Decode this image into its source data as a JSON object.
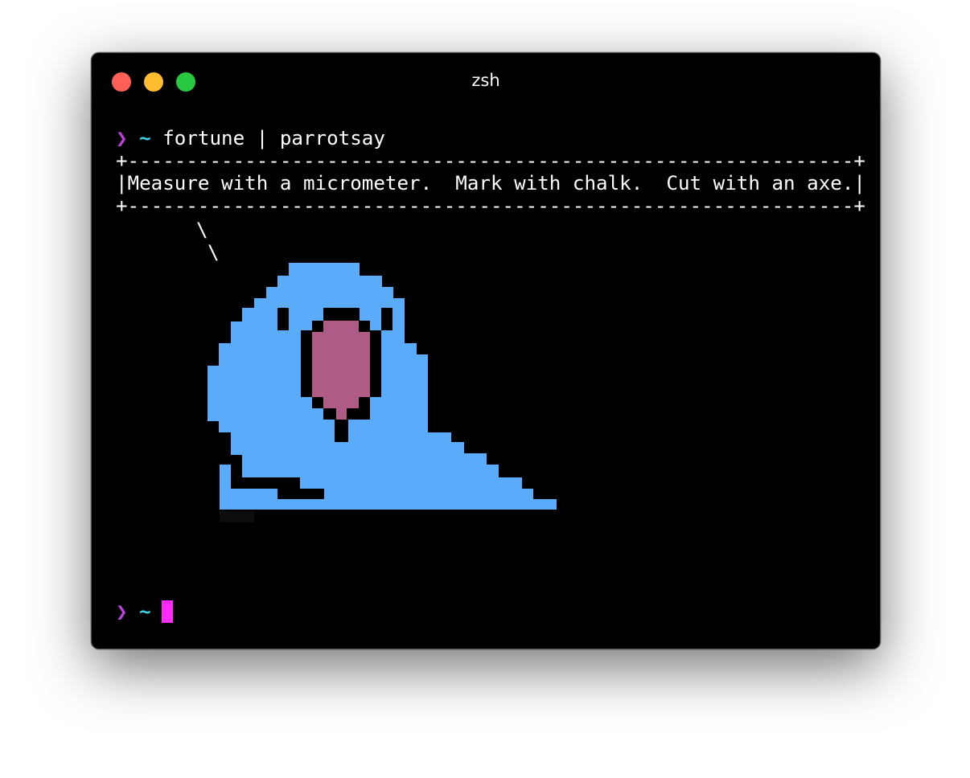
{
  "window": {
    "title": "zsh",
    "traffic_lights": {
      "close_color": "#ff5f57",
      "minimize_color": "#febc2e",
      "zoom_color": "#28c840"
    }
  },
  "terminal": {
    "prompt_symbol": "❯",
    "cwd": "~",
    "prompt_symbol_color": "#c13ee0",
    "cwd_color": "#3ad2e6",
    "command": "fortune | parrotsay",
    "output": {
      "border_top": "+--------------------------------------------------------------+",
      "message": "|Measure with a micrometer.  Mark with chalk.  Cut with an axe.|",
      "border_bottom": "+--------------------------------------------------------------+",
      "tail_1": "\\",
      "tail_2": "\\"
    },
    "parrot": {
      "body_color": "#5aabf9",
      "beak_color": "#ae5b85",
      "outline_color": "#000000"
    },
    "cursor_color": "#ff2aff"
  }
}
